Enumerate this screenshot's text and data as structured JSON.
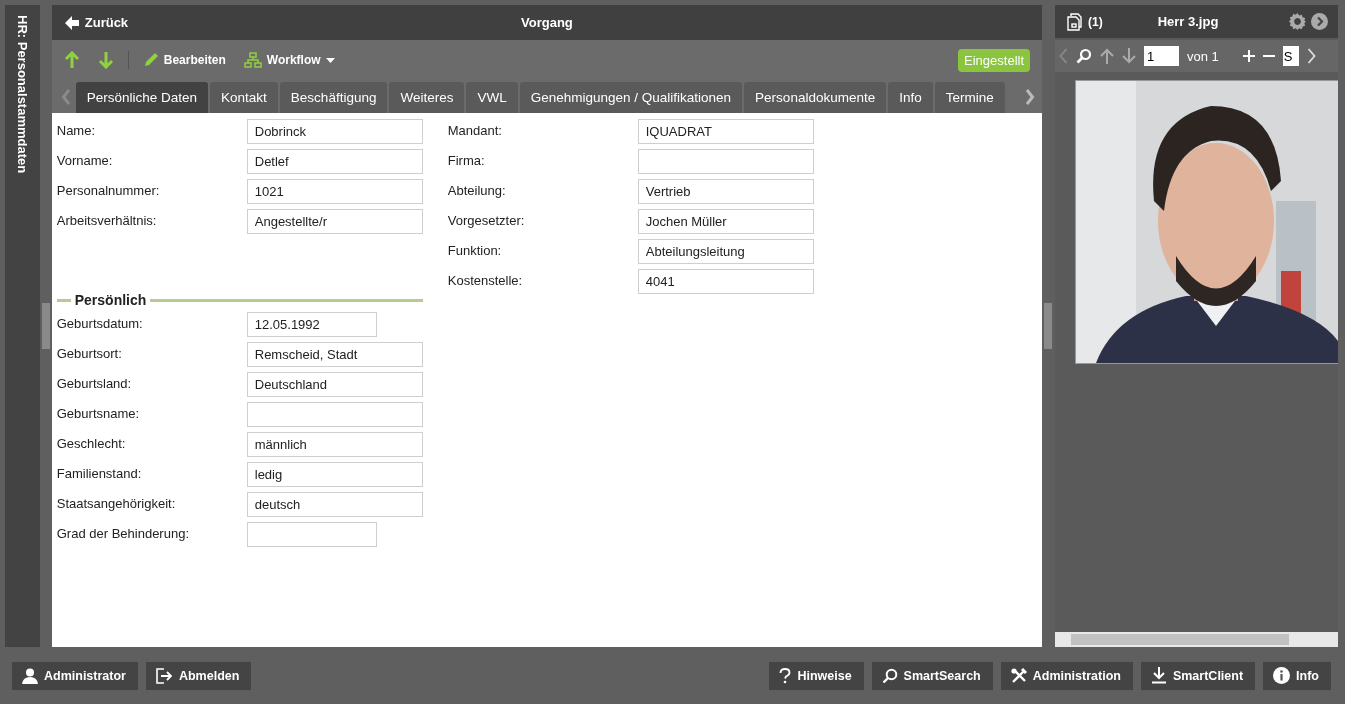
{
  "side_panel": {
    "title": "HR: Personalstammdaten"
  },
  "header": {
    "back": "Zurück",
    "title": "Vorgang"
  },
  "toolbar": {
    "edit": "Bearbeiten",
    "workflow": "Workflow",
    "status": "Eingestellt"
  },
  "tabs": [
    {
      "label": "Persönliche Daten",
      "selected": true
    },
    {
      "label": "Kontakt",
      "selected": false
    },
    {
      "label": "Beschäftigung",
      "selected": false
    },
    {
      "label": "Weiteres",
      "selected": false
    },
    {
      "label": "VWL",
      "selected": false
    },
    {
      "label": "Genehmigungen / Qualifikationen",
      "selected": false
    },
    {
      "label": "Personaldokumente",
      "selected": false
    },
    {
      "label": "Info",
      "selected": false
    },
    {
      "label": "Termine",
      "selected": false
    }
  ],
  "left_fields": [
    {
      "label": "Name:",
      "value": "Dobrinck",
      "short": false
    },
    {
      "label": "Vorname:",
      "value": "Detlef",
      "short": false
    },
    {
      "label": "Personalnummer:",
      "value": "1021",
      "short": false
    },
    {
      "label": "Arbeitsverhältnis:",
      "value": "Angestellte/r",
      "short": false
    }
  ],
  "right_fields": [
    {
      "label": "Mandant:",
      "value": "IQUADRAT",
      "short": false
    },
    {
      "label": "Firma:",
      "short": false
    },
    {
      "label": "Abteilung:",
      "value": "Vertrieb",
      "short": false
    },
    {
      "label": "Vorgesetzter:",
      "value": "Jochen Müller",
      "short": false
    },
    {
      "label": "Funktion:",
      "value": "Abteilungsleitung",
      "short": false
    },
    {
      "label": "Kostenstelle:",
      "value": "4041",
      "short": false
    }
  ],
  "section": {
    "title": "Persönlich",
    "fields": [
      {
        "label": "Geburtsdatum:",
        "value": "12.05.1992",
        "short": true
      },
      {
        "label": "Geburtsort:",
        "value": "Remscheid, Stadt",
        "short": false
      },
      {
        "label": "Geburtsland:",
        "value": "Deutschland",
        "short": false
      },
      {
        "label": "Geburtsname:",
        "short": false
      },
      {
        "label": "Geschlecht:",
        "value": "männlich",
        "short": false
      },
      {
        "label": "Familienstand:",
        "value": "ledig",
        "short": false
      },
      {
        "label": "Staatsangehörigkeit:",
        "value": "deutsch",
        "short": false
      },
      {
        "label": "Grad der Behinderung:",
        "short": true
      }
    ]
  },
  "viewer": {
    "count": "(1)",
    "title": "Herr 3.jpg",
    "page": "1",
    "of": "von 1",
    "zoom": "S"
  },
  "footer": {
    "left": [
      "Administrator",
      "Abmelden"
    ],
    "right": [
      "Hinweise",
      "SmartSearch",
      "Administration",
      "SmartClient",
      "Info"
    ]
  }
}
